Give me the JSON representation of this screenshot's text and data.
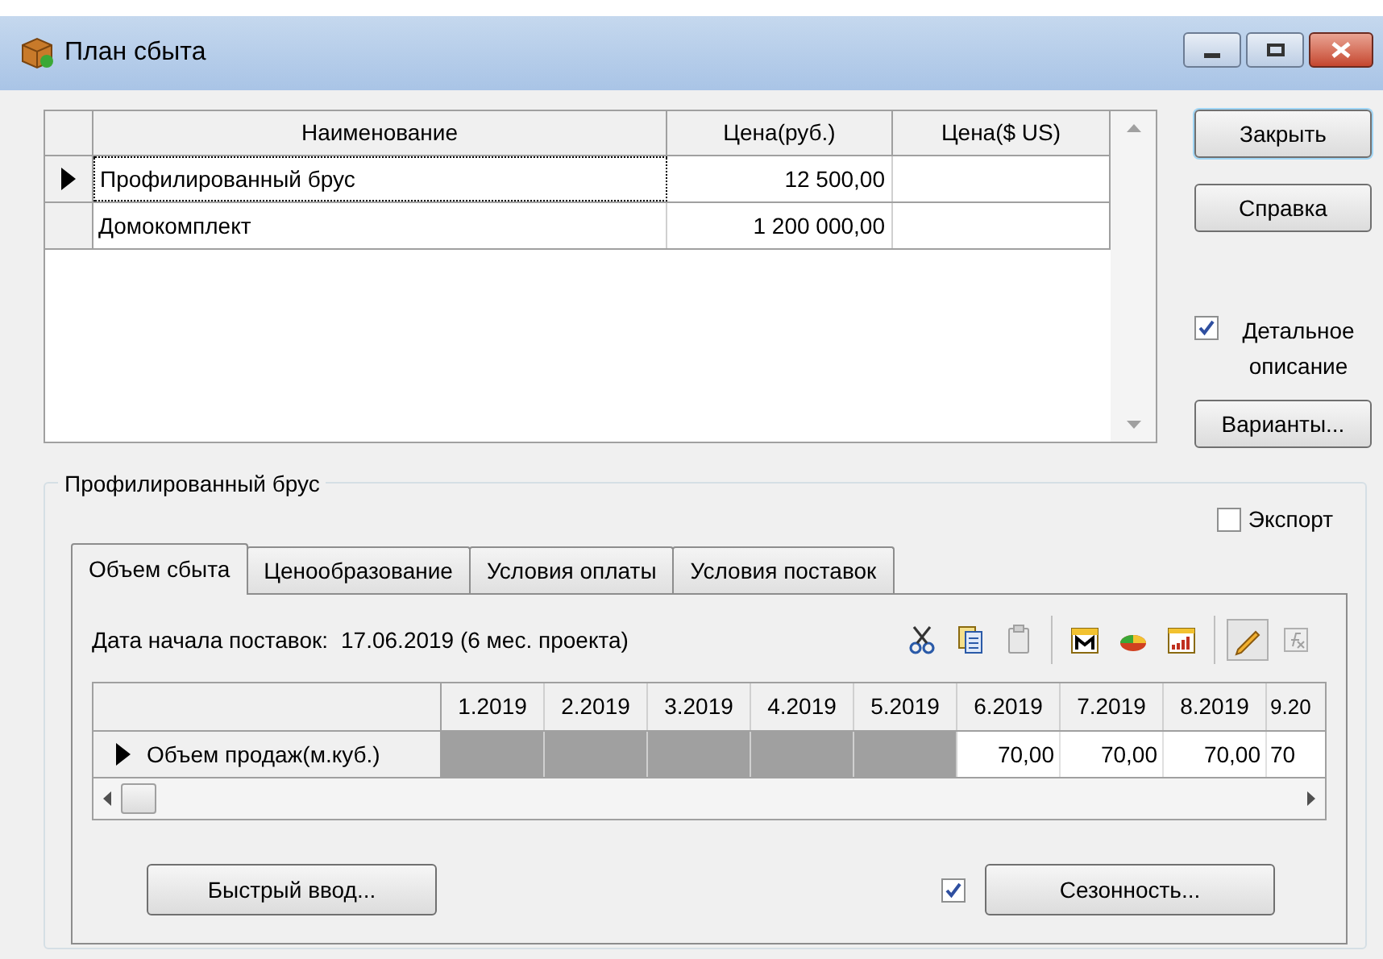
{
  "window": {
    "title": "План сбыта"
  },
  "products": {
    "columns": [
      "Наименование",
      "Цена(руб.)",
      "Цена($ US)"
    ],
    "rows": [
      {
        "name": "Профилированный брус",
        "price_rub": "12 500,00",
        "selected": true
      },
      {
        "name": "Домокомплект",
        "price_rub": "1 200 000,00",
        "selected": false
      }
    ]
  },
  "side_buttons": [
    {
      "kind": "button",
      "label": "Закрыть",
      "default": true
    },
    {
      "kind": "button",
      "label": "Справка",
      "default": false
    },
    {
      "kind": "checkbox",
      "label": "Детальное описание",
      "checked": true
    },
    {
      "kind": "button",
      "label": "Варианты...",
      "default": false
    }
  ],
  "group": {
    "title": "Профилированный брус",
    "export": {
      "label": "Экспорт",
      "checked": false
    },
    "tabs": [
      {
        "label": "Объем сбыта",
        "selected": true
      },
      {
        "label": "Ценообразование",
        "selected": false
      },
      {
        "label": "Условия оплаты",
        "selected": false
      },
      {
        "label": "Условия поставок",
        "selected": false
      }
    ],
    "start_date": {
      "label": "Дата начала поставок:",
      "value": "17.06.2019 (6 мес. проекта)"
    },
    "plan": {
      "columns": [
        "1.2019",
        "2.2019",
        "3.2019",
        "4.2019",
        "5.2019",
        "6.2019",
        "7.2019",
        "8.2019",
        "9.20"
      ],
      "rows": [
        {
          "name": "Объем продаж(м.куб.)",
          "selected": true,
          "cells": [
            {
              "disabled": true
            },
            {
              "disabled": true
            },
            {
              "disabled": true
            },
            {
              "disabled": true
            },
            {
              "disabled": true
            },
            {
              "value": "70,00",
              "disabled": false
            },
            {
              "value": "70,00",
              "disabled": false
            },
            {
              "value": "70,00",
              "disabled": false
            },
            {
              "value": "70",
              "disabled": false
            }
          ]
        }
      ]
    },
    "quick_input": "Быстрый ввод...",
    "seasonality": {
      "label": "Сезонность...",
      "checked": true
    }
  }
}
